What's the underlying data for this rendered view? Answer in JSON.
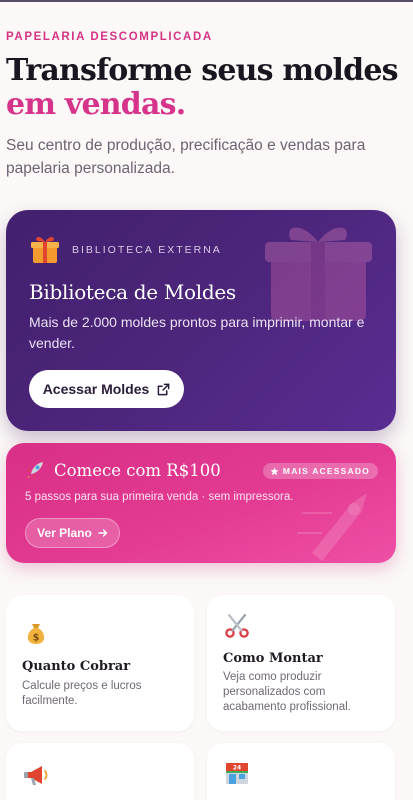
{
  "hero": {
    "eyebrow": "PAPELARIA DESCOMPLICADA",
    "title_line1": "Transforme seus moldes",
    "title_line2": "em vendas.",
    "subtitle": "Seu centro de produção, precificação e vendas para papelaria personalizada."
  },
  "library_card": {
    "tag": "BIBLIOTECA EXTERNA",
    "title": "Biblioteca de Moldes",
    "description": "Mais de 2.000 moldes prontos para imprimir, montar e vender.",
    "button_label": "Acessar Moldes",
    "icon": "gift-icon",
    "button_icon": "external-link-icon",
    "colors": {
      "bg_start": "#43206f",
      "bg_end": "#5a2c92"
    }
  },
  "plan_card": {
    "title": "Comece com R$100",
    "badge": "MAIS ACESSADO",
    "description": "5 passos para sua primeira venda · sem impressora.",
    "button_label": "Ver Plano",
    "icon": "rocket-icon",
    "badge_icon": "star-icon",
    "button_icon": "arrow-right-icon",
    "colors": {
      "bg_start": "#d92f86",
      "bg_end": "#ee4fa4"
    }
  },
  "features": [
    {
      "title": "Quanto Cobrar",
      "description": "Calcule preços e lucros facilmente.",
      "icon": "money-bag-icon"
    },
    {
      "title": "Como Montar",
      "description": "Veja como produzir personalizados com acabamento profissional.",
      "icon": "scissors-icon"
    },
    {
      "title": "",
      "description": "",
      "icon": "megaphone-icon"
    },
    {
      "title": "",
      "description": "",
      "icon": "convenience-store-icon"
    }
  ],
  "colors": {
    "accent": "#d6338a",
    "background": "#fbf8f7"
  }
}
